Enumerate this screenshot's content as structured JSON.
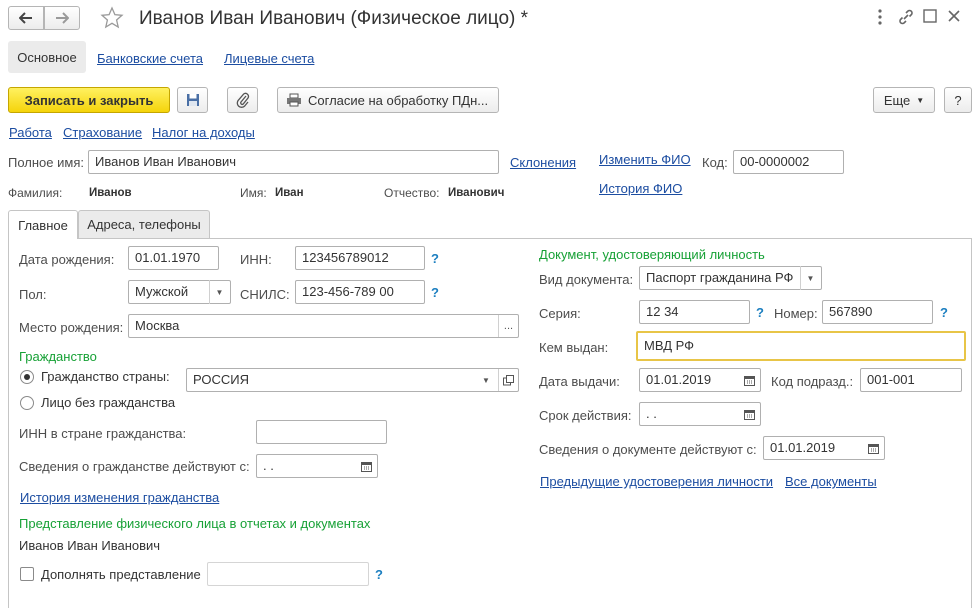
{
  "window": {
    "title": "Иванов Иван Иванович (Физическое лицо) *",
    "nav_back_icon": "arrow-left-icon",
    "nav_forward_icon": "arrow-right-icon",
    "favorite_icon": "star-icon",
    "more_icon": "vertical-dots-icon",
    "link_icon": "chain-link-icon",
    "maximize_icon": "maximize-icon",
    "close_icon": "close-icon"
  },
  "nav_tabs": [
    {
      "label": "Основное",
      "active": true
    },
    {
      "label": "Банковские счета"
    },
    {
      "label": "Лицевые счета"
    }
  ],
  "toolbar": {
    "save_close": "Записать и закрыть",
    "consent": "Согласие на обработку ПДн...",
    "more": "Еще",
    "help": "?"
  },
  "top_links": [
    "Работа",
    "Страхование",
    "Налог на доходы"
  ],
  "fullname": {
    "label": "Полное имя:",
    "value": "Иванов Иван Иванович",
    "declensions": "Склонения",
    "change_fio": "Изменить ФИО",
    "history_fio": "История ФИО",
    "code_label": "Код:",
    "code_value": "00-0000002"
  },
  "name_parts": {
    "surname_label": "Фамилия:",
    "surname": "Иванов",
    "name_label": "Имя:",
    "name": "Иван",
    "patronymic_label": "Отчество:",
    "patronymic": "Иванович"
  },
  "tabs": [
    {
      "label": "Главное",
      "active": true
    },
    {
      "label": "Адреса, телефоны"
    }
  ],
  "left": {
    "birth_date_label": "Дата рождения:",
    "birth_date": "01.01.1970",
    "inn_label": "ИНН:",
    "inn": "123456789012",
    "gender_label": "Пол:",
    "gender": "Мужской",
    "snils_label": "СНИЛС:",
    "snils": "123-456-789 00",
    "birthplace_label": "Место рождения:",
    "birthplace": "Москва",
    "citizenship_header": "Гражданство",
    "citizenship_country_label": "Гражданство страны:",
    "citizenship_country": "РОССИЯ",
    "stateless_label": "Лицо без гражданства",
    "foreign_inn_label": "ИНН в стране гражданства:",
    "foreign_inn": "",
    "citizenship_valid_label": "Сведения о гражданстве действуют с:",
    "citizenship_valid": " .  .",
    "citizenship_history": "История изменения гражданства",
    "representation_header": "Представление физического лица в отчетах и документах",
    "representation": "Иванов Иван Иванович",
    "supplement_label": "Дополнять представление",
    "supplement": "",
    "help": "?"
  },
  "right": {
    "header": "Документ, удостоверяющий личность",
    "doc_type_label": "Вид документа:",
    "doc_type": "Паспорт гражданина РФ",
    "series_label": "Серия:",
    "series": "12 34",
    "number_label": "Номер:",
    "number": "567890",
    "issued_by_label": "Кем выдан:",
    "issued_by": "МВД РФ",
    "issue_date_label": "Дата выдачи:",
    "issue_date": "01.01.2019",
    "dept_code_label": "Код подразд.:",
    "dept_code": "001-001",
    "validity_label": "Срок действия:",
    "validity": " .  .",
    "doc_valid_label": "Сведения о документе действуют с:",
    "doc_valid": "01.01.2019",
    "previous_docs": "Предыдущие удостоверения личности",
    "all_docs": "Все документы",
    "help": "?"
  },
  "colors": {
    "accent_yellow": "#f5d40b",
    "link_blue": "#1c4da1",
    "section_green": "#17a136",
    "focus_border": "#e8c547"
  }
}
